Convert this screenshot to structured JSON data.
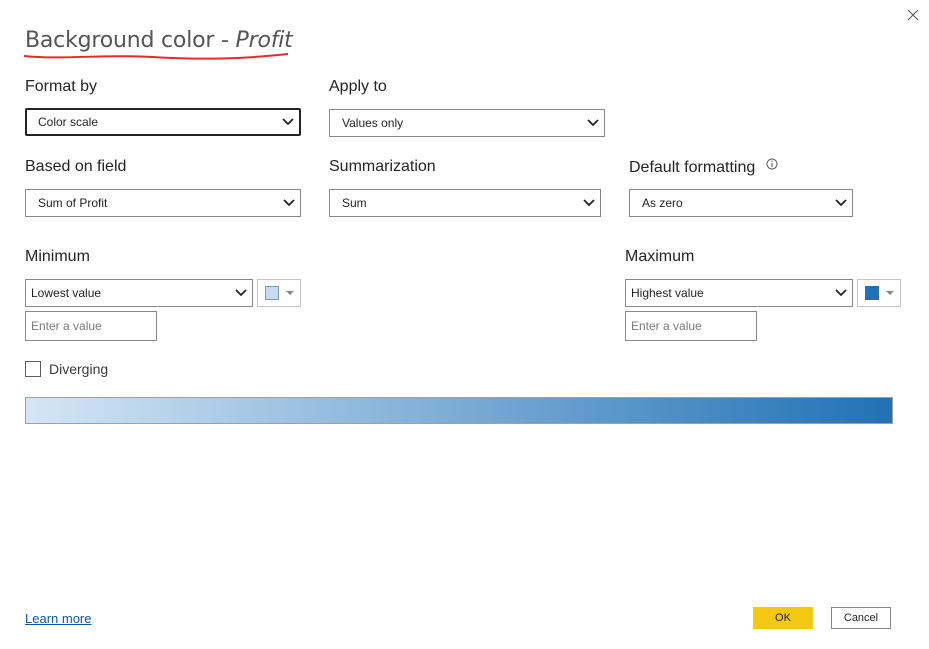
{
  "dialog": {
    "title_prefix": "Background color - ",
    "title_field": "Profit",
    "close_icon": "close-icon"
  },
  "format_by": {
    "label": "Format by",
    "value": "Color scale"
  },
  "apply_to": {
    "label": "Apply to",
    "value": "Values only"
  },
  "based_on_field": {
    "label": "Based on field",
    "value": "Sum of Profit"
  },
  "summarization": {
    "label": "Summarization",
    "value": "Sum"
  },
  "default_formatting": {
    "label": "Default formatting",
    "info_icon": "info-icon",
    "value": "As zero"
  },
  "minimum": {
    "label": "Minimum",
    "value": "Lowest value",
    "color": "#c6dbef",
    "input_placeholder": "Enter a value"
  },
  "maximum": {
    "label": "Maximum",
    "value": "Highest value",
    "color": "#2171b5",
    "input_placeholder": "Enter a value"
  },
  "diverging": {
    "label": "Diverging",
    "checked": false
  },
  "gradient": {
    "from": "#d5e6f5",
    "to": "#2171b5"
  },
  "footer": {
    "learn_more": "Learn more",
    "ok_label": "OK",
    "cancel_label": "Cancel"
  }
}
